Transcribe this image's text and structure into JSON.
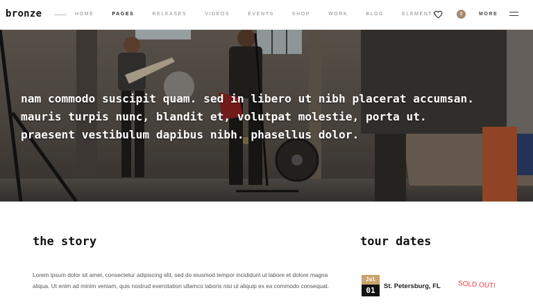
{
  "header": {
    "logo": "bronze",
    "nav": [
      "HOME",
      "PAGES",
      "RELEASES",
      "VIDEOS",
      "EVENTS",
      "SHOP",
      "WORK",
      "BLOG",
      "ELEMENTS"
    ],
    "active_nav": "PAGES",
    "cart_count": "0",
    "more_label": "MORE"
  },
  "hero": {
    "lines": [
      "nam commodo suscipit quam. sed in libero ut nibh placerat accumsan.",
      "mauris turpis nunc, blandit et, volutpat molestie, porta ut.",
      "praesent vestibulum dapibus nibh. phasellus dolor."
    ]
  },
  "story": {
    "title": "the story",
    "text": "Lorem ipsum dolor sit amet, consectetur adipiscing elit, sed do eiusmod tempor incididunt ut labore et dolore magna aliqua. Ut enim ad minim veniam, quis nostrud exercitation ullamco laboris nisi ut aliquip ex ea commodo consequat."
  },
  "tour": {
    "title": "tour dates",
    "dates": [
      {
        "month": "Jul",
        "day": "01",
        "city": "St. Petersburg, FL",
        "status": "SOLD OUT!"
      }
    ]
  },
  "colors": {
    "accent": "#c9a36b",
    "badge": "#a78b6c",
    "sold_out": "#e53b3b"
  }
}
